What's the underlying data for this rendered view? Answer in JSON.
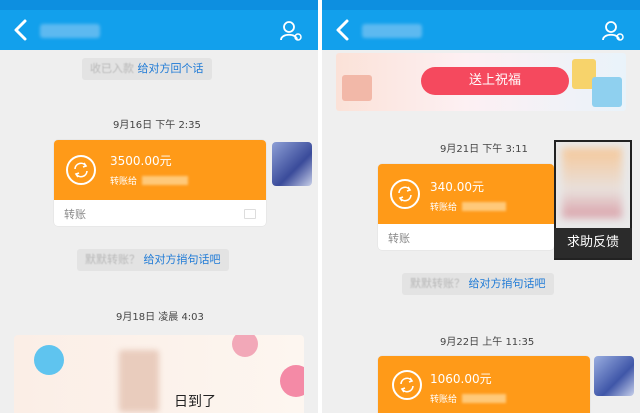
{
  "left": {
    "system_notice": {
      "muted": "收已入款",
      "link": "给对方回个话"
    },
    "timestamp_1": "9月16日 下午 2:35",
    "transfer": {
      "amount": "3500.00元",
      "to": "转账给",
      "label": "转账"
    },
    "silent_notice": {
      "muted": "默默转账？",
      "link": "给对方捎句话吧"
    },
    "timestamp_2": "9月18日 凌晨 4:03",
    "sticker_text": "日到了"
  },
  "right": {
    "gift_button": "送上祝福",
    "timestamp_1": "9月21日 下午 3:11",
    "transfer": {
      "amount": "340.00元",
      "to": "转账给",
      "label": "转账"
    },
    "feedback_button": "求助反馈",
    "silent_notice": {
      "muted": "默默转账？",
      "link": "给对方捎句话吧"
    },
    "timestamp_2": "9月22日 上午 11:35",
    "transfer_2": {
      "amount": "1060.00元",
      "to": "转账给"
    }
  },
  "colors": {
    "nav": "#12a0ec",
    "transfer_card": "#ff9a18",
    "link": "#1e7ad6",
    "gift_button": "#f5495e"
  },
  "icons": [
    "back-icon",
    "profile-icon",
    "transfer-coin-icon"
  ]
}
